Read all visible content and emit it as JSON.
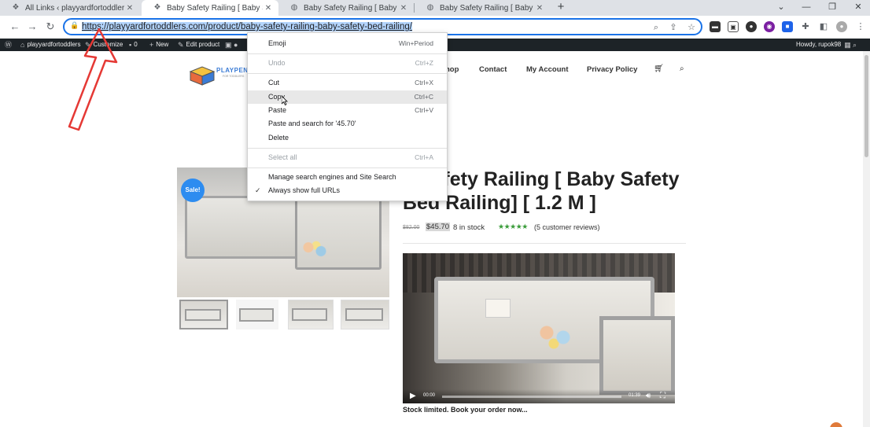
{
  "tabs": [
    {
      "title": "All Links ‹ playyardfortoddlers —",
      "active": false
    },
    {
      "title": "Baby Safety Railing [ Baby Safety",
      "active": true
    },
    {
      "title": "Baby Safety Railing [ Baby Safety",
      "active": false
    },
    {
      "title": "Baby Safety Railing [ Baby Safety",
      "active": false
    }
  ],
  "omnibox": {
    "url": "https://playyardfortoddlers.com/product/baby-safety-railing-baby-safety-bed-railing/"
  },
  "wpbar": {
    "site": "playyardfortoddlers",
    "customize": "Customize",
    "comments": "0",
    "new": "New",
    "edit": "Edit product",
    "howdy": "Howdy, rupok98"
  },
  "site": {
    "logo_text": "PLAYPEN",
    "logo_sub": "FOR TODDLERS",
    "nav": [
      "hop",
      "Contact",
      "My Account",
      "Privacy Policy"
    ]
  },
  "product": {
    "sale_badge": "Sale!",
    "title": "y Safety Railing [ Baby Safety Bed Railing] [ 1.2 M ]",
    "old_price": "$82.00",
    "price": "$45.70",
    "stock": "8 in stock",
    "stars": "★★★★★",
    "reviews": "(5 customer reviews)",
    "video_time_start": "00:00",
    "video_time_end": "01:39",
    "stock_note": "Stock limited. Book your order now..."
  },
  "context_menu": {
    "emoji": "Emoji",
    "emoji_sc": "Win+Period",
    "undo": "Undo",
    "undo_sc": "Ctrl+Z",
    "cut": "Cut",
    "cut_sc": "Ctrl+X",
    "copy": "Copy",
    "copy_sc": "Ctrl+C",
    "paste": "Paste",
    "paste_sc": "Ctrl+V",
    "paste_search": "Paste and search for '45.70'",
    "delete": "Delete",
    "select_all": "Select all",
    "select_all_sc": "Ctrl+A",
    "manage": "Manage search engines and Site Search",
    "show_urls": "Always show full URLs"
  },
  "colors": {
    "accent": "#1a73e8",
    "wpbar": "#1d2327",
    "sale": "#2d8cf0",
    "stars": "#3a9c3a",
    "arrow": "#e53935"
  }
}
